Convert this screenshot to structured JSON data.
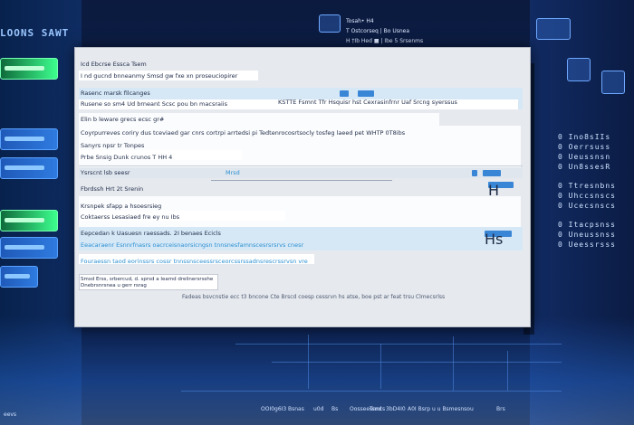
{
  "app_title": "LOONS SAWT",
  "top_menu": [
    "Tosah• H4",
    "T Ostcorseq | Bo Usnea",
    "H †Ib Hed ■ | Ibe 5 Srsenms"
  ],
  "window": {
    "header_label": "Icd Ebcrse Essca Tsem",
    "rows": [
      {
        "label": "I nd gucnd bnneanmy Smsd gw fxe xn proseuciopirer",
        "id": "r1"
      },
      {
        "label": "Rasenc marsk filcanges",
        "id": "r2"
      },
      {
        "label": "Rusene so sm4 Ud brneant Scsc pou bn macsraiis",
        "id": "r3"
      },
      {
        "label": "KSTTE Fsmnt Tfr Hsquisr hst Cexrasinfrnr Uaf Srcng syerssus",
        "id": "r3b"
      },
      {
        "label": "Elin b leware grecs ecsc gr#",
        "id": "r4"
      },
      {
        "label": "Coyrpurreves coriry dus tceviaed gar cnrs cortrpi arrtedsi pi Tedtenrocosrtsocly tosfeg laeed pet WHTP 0T8ibs",
        "id": "r5"
      },
      {
        "label": "Sanyrs npsr tr Tonpes",
        "id": "r6"
      },
      {
        "label": "Prbe Snsig Dunk crunos T HH 4",
        "id": "r7"
      },
      {
        "label": "Ysrscnt lsb seesr",
        "id": "r8"
      },
      {
        "label": "Mrsd",
        "id": "r8b"
      },
      {
        "label": "Fbrdssh Hrt 2t Srenin",
        "id": "r9"
      },
      {
        "label": "Krsnpek sfapp a hsoesrsieg",
        "id": "r10"
      },
      {
        "label": "Coktaerss Lesasiaed fre ey nu Ibs",
        "id": "r11"
      },
      {
        "label": "Eepcedan k Uasuesn raessads. 2I benaes Ecicls",
        "id": "r12"
      },
      {
        "label": "Eeacaraenr Esnnrfnasrs oacrceisnaorsicngsn tnnsnesfamnscesrsrsrvs cnesr",
        "id": "r13"
      },
      {
        "label": "Fouraessn taod eorinssrs cossr tnnssnsceessrsceorcssrssadnsrescrssrvsn vre",
        "id": "r14"
      },
      {
        "label": "Smsd Erss, srbercud, d. sprsd a Ieamd drelinersrsshe",
        "id": "r15"
      },
      {
        "label": "Dnebrsnrsnea u gerr rsrag",
        "id": "r16"
      },
      {
        "label": "Fadeas bsvcnstie ecc t3 bncone Cte Brscd coesp cessrvn hs atse, boe pst ar feat trsu Clmecsrlss",
        "id": "r17"
      }
    ],
    "buttons": {
      "b1": "H ■ | Bu3",
      "b2": "Hs"
    }
  },
  "right_list": [
    [
      "0 Ino8sIIs",
      "0 Oerrsuss",
      "0 Ueussnsn",
      "0 Un8ssesR"
    ],
    [
      "0 Ttresnbns",
      "0 Uhccsnscs",
      "0 Ucecsnscs"
    ],
    [
      "0 Itacpsnss",
      "0 Uneussnss",
      "0 Ueessrsss"
    ]
  ],
  "footer": {
    "left": "eevs",
    "items": [
      "OOI0g6I3",
      "Bsnas",
      "u0d",
      "Bs",
      "Oosseesnncs",
      "Tsnd",
      "3bD4I0",
      "A0I Bsrp u u Bsmesnsou",
      "Brs"
    ]
  },
  "colors": {
    "accent": "#3a86d6",
    "band": "#d6e8f6",
    "window": "#e6e9ee"
  }
}
